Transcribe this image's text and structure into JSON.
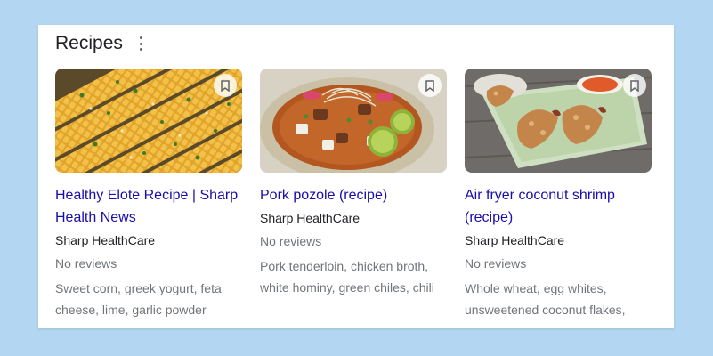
{
  "header": {
    "title": "Recipes",
    "more_icon": "more-vert-icon"
  },
  "recipes": [
    {
      "name": "Healthy Elote Recipe | Sharp Health News",
      "source": "Sharp HealthCare",
      "reviews": "No reviews",
      "ingredients": "Sweet corn, greek yogurt, feta cheese, lime, garlic powder",
      "image": "grilled-corn-image"
    },
    {
      "name": "Pork pozole (recipe)",
      "source": "Sharp HealthCare",
      "reviews": "No reviews",
      "ingredients": "Pork tenderloin, chicken broth, white hominy, green chiles, chili",
      "image": "pozole-bowl-image"
    },
    {
      "name": "Air fryer coconut shrimp (recipe)",
      "source": "Sharp HealthCare",
      "reviews": "No reviews",
      "ingredients": "Whole wheat, egg whites, unsweetened coconut flakes,",
      "image": "coconut-shrimp-image"
    }
  ],
  "colors": {
    "background": "#b3d7f2",
    "link": "#1a0dab",
    "text": "#202124",
    "muted": "#70757a"
  }
}
